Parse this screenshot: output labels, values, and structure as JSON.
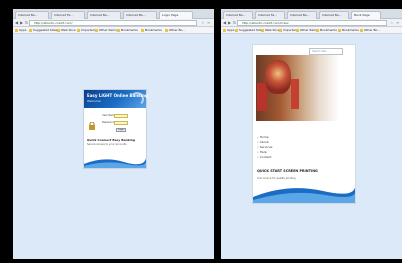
{
  "left_window": {
    "tabs": [
      "Internet Ba...",
      "Internet Fa...",
      "Internet Ba...",
      "Internet Ba...",
      "Login Page"
    ],
    "address": "http://atlantic-credit.com/",
    "bookmarks": [
      "Apps",
      "Suggested Sites",
      "Web Slice",
      "Imported",
      "Other Items",
      "Bookmarks",
      "Bookmarks",
      "Other Bo..."
    ],
    "login": {
      "banner_title": "Easy LIGHT Online Banking",
      "banner_subtitle": "Welcome",
      "username_label": "User Name",
      "password_label": "Password",
      "login_button": "Login",
      "footer_title": "Quick Connect Easy Banking",
      "footer_text": "Secure access to your accounts"
    },
    "colors": {
      "banner": "#1b6cc4",
      "field_bg": "#fff8b0",
      "page_bg": "#dce9f8"
    }
  },
  "right_window": {
    "tabs": [
      "Internet Ba...",
      "Internet Fa...",
      "Internet Ba...",
      "Internet Ba...",
      "Bank Page"
    ],
    "address": "http://atlantic-credit.com/index",
    "bookmarks": [
      "Apps",
      "Suggested Sites",
      "Web Slice",
      "Imported",
      "Other Items",
      "Bookmarks",
      "Bookmarks",
      "Other Bo..."
    ],
    "page": {
      "search_placeholder": "Search Site...",
      "menu": [
        "Home",
        "About",
        "Services",
        "Help",
        "Contact"
      ],
      "footer_title": "QUICK START SCREEN PRINTING",
      "footer_text": "Your source for quality printing"
    }
  }
}
